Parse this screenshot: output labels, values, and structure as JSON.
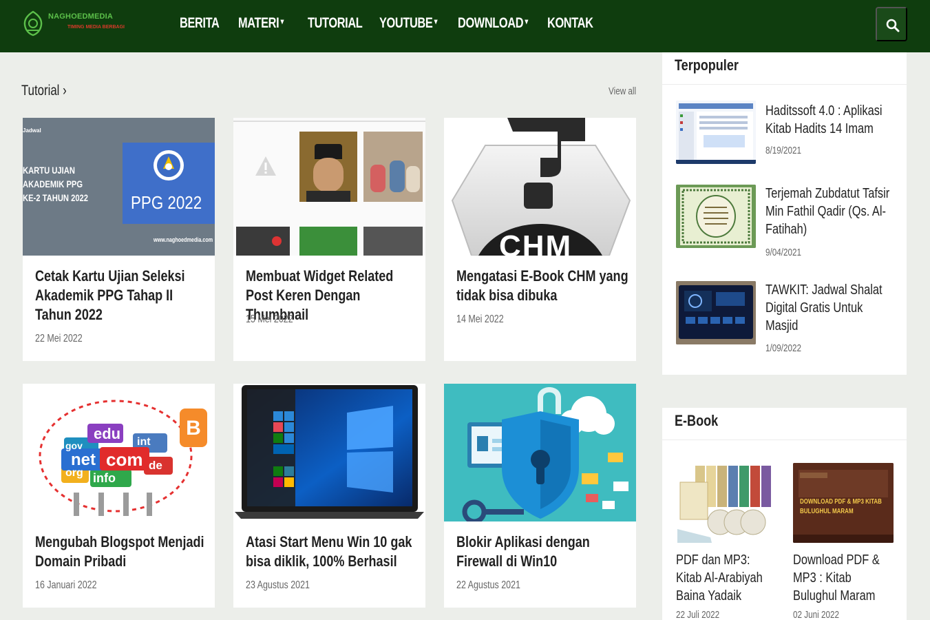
{
  "site": {
    "logo_title": "NAGHOEDMEDIA",
    "logo_subtitle": "TIMING MEDIA BERBAGI"
  },
  "nav": {
    "items": [
      {
        "label": "BERITA",
        "has_dropdown": false
      },
      {
        "label": "MATERI",
        "has_dropdown": true
      },
      {
        "label": "TUTORIAL",
        "has_dropdown": false
      },
      {
        "label": "YOUTUBE",
        "has_dropdown": true
      },
      {
        "label": "DOWNLOAD",
        "has_dropdown": true
      },
      {
        "label": "KONTAK",
        "has_dropdown": false
      }
    ],
    "dropdown_glyph": "▾",
    "search_icon": "search-icon"
  },
  "section": {
    "title": "Tutorial ›",
    "view_all": "View all"
  },
  "posts": [
    {
      "title": "Cetak Kartu Ujian Seleksi Akademik PPG Tahap II Tahun 2022",
      "date": "22 Mei 2022",
      "thumb": {
        "lines": [
          "KARTU UJIAN",
          "AKADEMIK PPG",
          "KE-2 TAHUN 2022"
        ],
        "badge": "PPG 2022",
        "credit": "www.naghoedmedia.com",
        "tag": "Jadwal"
      }
    },
    {
      "title": "Membuat Widget Related Post Keren Dengan Thumbnail",
      "date": "15 Mei 2022"
    },
    {
      "title": "Mengatasi E-Book CHM yang tidak bisa dibuka",
      "date": "14 Mei 2022",
      "thumb": {
        "label": "CHM"
      }
    },
    {
      "title": "Mengubah Blogspot Menjadi Domain Pribadi",
      "date": "16 Januari 2022",
      "thumb": {
        "words": [
          "edu",
          "net",
          "com",
          "info",
          "gov",
          "int",
          "de",
          "org"
        ]
      }
    },
    {
      "title": "Atasi Start Menu Win 10 gak bisa diklik, 100% Berhasil",
      "date": "23 Agustus 2021"
    },
    {
      "title": "Blokir Aplikasi dengan Firewall di Win10",
      "date": "22 Agustus 2021"
    }
  ],
  "sidebar": {
    "popular": {
      "title": "Terpopuler",
      "items": [
        {
          "title": "Haditssoft 4.0 : Aplikasi Kitab Hadits 14 Imam",
          "date": "8/19/2021"
        },
        {
          "title": "Terjemah Zubdatut Tafsir Min Fathil Qadir (Qs. Al-Fatihah)",
          "date": "9/04/2021"
        },
        {
          "title": "TAWKIT: Jadwal Shalat Digital Gratis Untuk Masjid",
          "date": "1/09/2022"
        }
      ]
    },
    "ebook": {
      "title": "E-Book",
      "items": [
        {
          "title": "PDF dan MP3: Kitab Al-Arabiyah Baina Yadaik",
          "date": "22 Juli 2022"
        },
        {
          "title": "Download PDF & MP3 : Kitab Bulughul Maram",
          "date": "02 Juni 2022",
          "thumb": {
            "text": "DOWNLOAD PDF & MP3 KITAB BULUGHUL MARAM"
          }
        }
      ]
    }
  },
  "colors": {
    "nav_bg": "#0f3d0e",
    "page_bg": "#eceeea",
    "card_bg": "#ffffff",
    "text": "#222222",
    "date": "#666666"
  }
}
